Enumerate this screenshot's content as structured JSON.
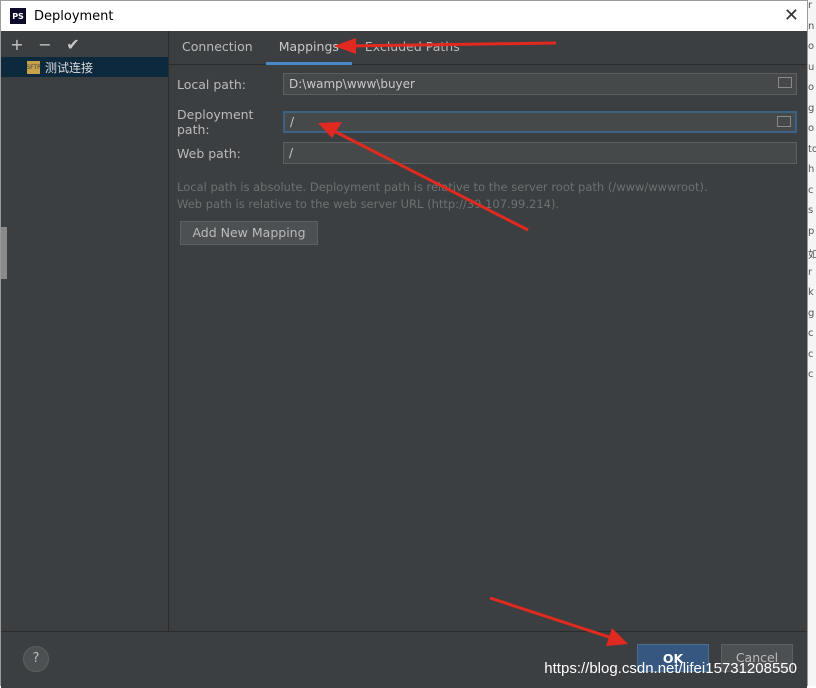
{
  "window": {
    "title": "Deployment",
    "app_icon_text": "PS"
  },
  "sidebar": {
    "toolbar": {
      "add": "+",
      "remove": "−",
      "confirm": "✔"
    },
    "server": {
      "name": "测试连接",
      "icon": "sftp-icon"
    }
  },
  "tabs": [
    "Connection",
    "Mappings",
    "Excluded Paths"
  ],
  "mappings": {
    "local_path_label": "Local path:",
    "local_path_value": "D:\\wamp\\www\\buyer",
    "deployment_path_label": "Deployment path:",
    "deployment_path_value": "/",
    "web_path_label": "Web path:",
    "web_path_value": "/",
    "hint_line1": "Local path is absolute. Deployment path is relative to the server root path (/www/wwwroot).",
    "hint_line2": "Web path is relative to the web server URL (http://39.107.99.214).",
    "add_button": "Add New Mapping"
  },
  "footer": {
    "help": "?",
    "ok": "OK",
    "cancel": "Cancel"
  },
  "watermark": "https://blog.csdn.net/lifei15731208550",
  "colors": {
    "arrow": "#e02a1f",
    "accent": "#4a88c7",
    "ok_bg": "#365880"
  },
  "right_edge_chars": [
    "r",
    "n",
    "o",
    "u",
    "o",
    "g",
    "o",
    "to",
    "h",
    "c",
    "s",
    "p",
    "如",
    "r",
    "k",
    "g",
    "c",
    "c",
    "c"
  ]
}
